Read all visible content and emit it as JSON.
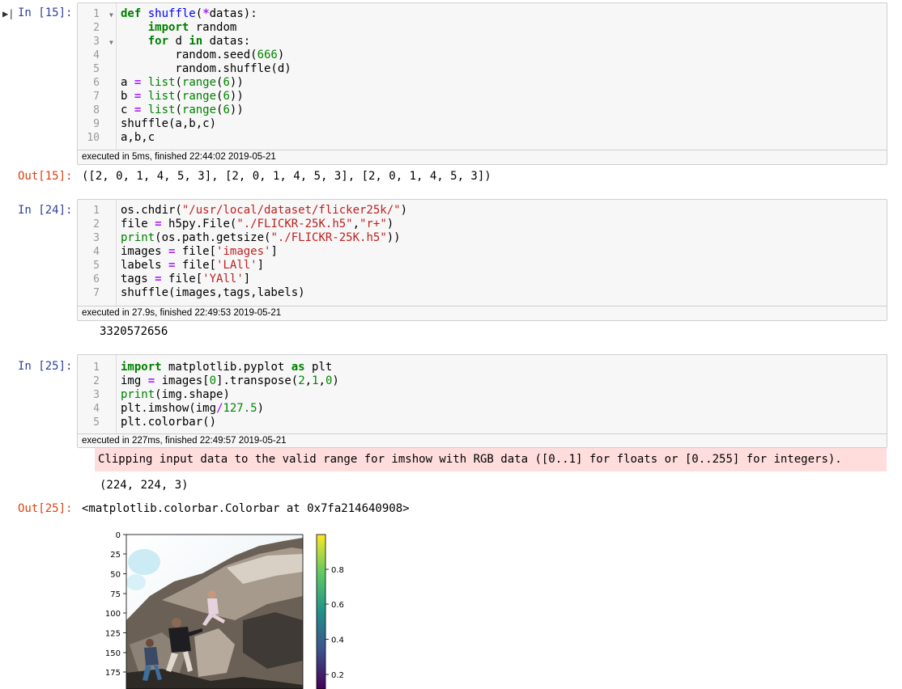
{
  "cells": [
    {
      "in_prompt": "In [15]:",
      "lines": [
        "1",
        "2",
        "3",
        "4",
        "5",
        "6",
        "7",
        "8",
        "9",
        "10"
      ],
      "exec_info": "executed in 5ms, finished 22:44:02 2019-05-21",
      "out_prompt": "Out[15]:",
      "output": "([2, 0, 1, 4, 5, 3], [2, 0, 1, 4, 5, 3], [2, 0, 1, 4, 5, 3])"
    },
    {
      "in_prompt": "In [24]:",
      "lines": [
        "1",
        "2",
        "3",
        "4",
        "5",
        "6",
        "7"
      ],
      "exec_info": "executed in 27.9s, finished 22:49:53 2019-05-21",
      "output": "3320572656"
    },
    {
      "in_prompt": "In [25]:",
      "lines": [
        "1",
        "2",
        "3",
        "4",
        "5"
      ],
      "exec_info": "executed in 227ms, finished 22:49:57 2019-05-21",
      "stderr": "Clipping input data to the valid range for imshow with RGB data ([0..1] for floats or [0..255] for integers).",
      "stdout": "(224, 224, 3)",
      "out_prompt": "Out[25]:",
      "output": "<matplotlib.colorbar.Colorbar at 0x7fa214640908>"
    }
  ],
  "chart_data": {
    "type": "heatmap",
    "title": "",
    "y_ticks": [
      "0",
      "25",
      "50",
      "75",
      "100",
      "125",
      "150",
      "175"
    ],
    "colorbar_ticks": [
      "0.8",
      "0.6",
      "0.4",
      "0.2"
    ],
    "colormap": "viridis",
    "image_description": "photo"
  },
  "colors": {
    "in_prompt": "#303f9f",
    "out_prompt": "#d84315",
    "keyword": "#008000",
    "string": "#ba2121",
    "stderr_bg": "#ffdddd"
  }
}
